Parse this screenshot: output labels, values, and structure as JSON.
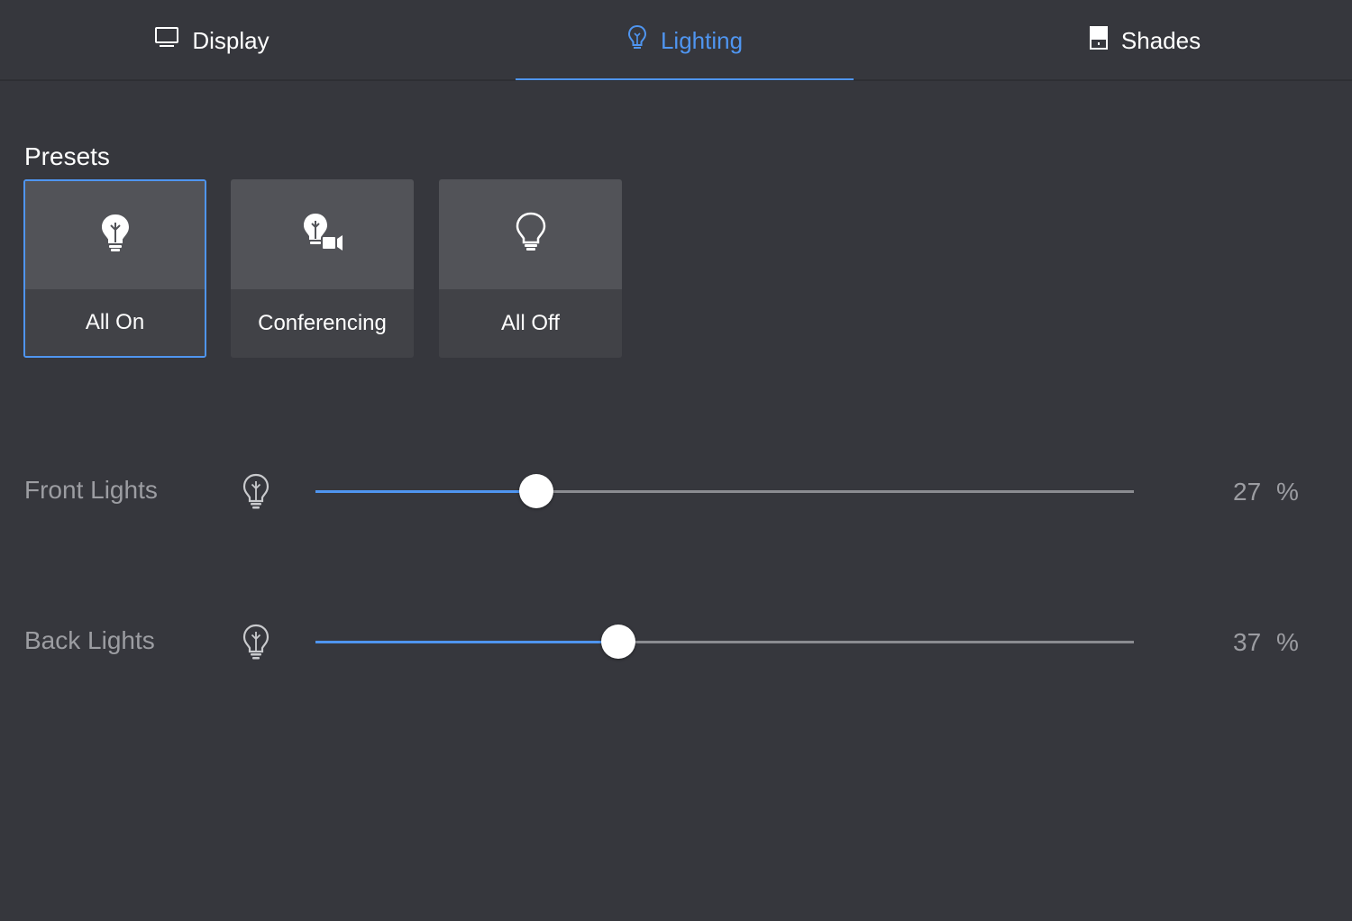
{
  "tabs": [
    {
      "label": "Display",
      "icon": "monitor-icon",
      "active": false
    },
    {
      "label": "Lighting",
      "icon": "lightbulb-icon",
      "active": true
    },
    {
      "label": "Shades",
      "icon": "shade-icon",
      "active": false
    }
  ],
  "presets": {
    "title": "Presets",
    "items": [
      {
        "label": "All On",
        "icon": "lightbulb-on-icon",
        "selected": true
      },
      {
        "label": "Conferencing",
        "icon": "lightbulb-camera-icon",
        "selected": false
      },
      {
        "label": "All Off",
        "icon": "lightbulb-off-icon",
        "selected": false
      }
    ]
  },
  "sliders": [
    {
      "label": "Front Lights",
      "value": 27,
      "unit": "%"
    },
    {
      "label": "Back Lights",
      "value": 37,
      "unit": "%"
    }
  ],
  "colors": {
    "accent": "#4f95f0",
    "background": "#36373d",
    "muted_text": "#9c9da2"
  }
}
